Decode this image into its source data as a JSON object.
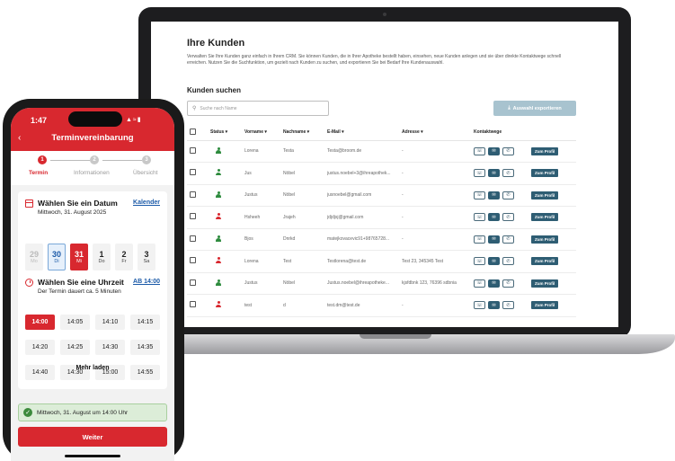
{
  "crm": {
    "title": "Ihre Kunden",
    "description": "Verwalten Sie Ihre Kunden ganz einfach in Ihrem CRM. Sie können Kunden, die in Ihrer Apotheke bestellt haben, einsehen, neue Kunden anlegen und sie über direkte Kontaktwege schnell erreichen. Nutzen Sie die Suchfunktion, um gezielt nach Kunden zu suchen, und exportieren Sie bei Bedarf Ihre Kundenauswahl.",
    "search_heading": "Kunden suchen",
    "search_placeholder": "Suche nach Name",
    "export_label": "Auswahl exportieren",
    "columns": [
      "Status ▾",
      "Vorname ▾",
      "Nachname ▾",
      "E-Mail ▾",
      "Adresse ▾",
      "Kontaktwege"
    ],
    "profile_label": "Zum Profil",
    "status_colors": {
      "active": "#2e8b3e",
      "inactive": "#d8282f"
    },
    "rows": [
      {
        "status": "active",
        "vorname": "Lorena",
        "nachname": "Testa",
        "email": "Testa@broom.de",
        "adresse": "-"
      },
      {
        "status": "active",
        "vorname": "Jus",
        "nachname": "Nöbel",
        "email": "justus.noebel+3@ihreapothek...",
        "adresse": "-"
      },
      {
        "status": "active",
        "vorname": "Justus",
        "nachname": "Nöbel",
        "email": "jusnoebel@gmail.com",
        "adresse": "-"
      },
      {
        "status": "inactive",
        "vorname": "Hsheeh",
        "nachname": "Jrajeh",
        "email": "jdjdjsj@gmail.com",
        "adresse": "-"
      },
      {
        "status": "active",
        "vorname": "Bjos",
        "nachname": "Dnrkd",
        "email": "matejkovacevic91+98765728...",
        "adresse": "-"
      },
      {
        "status": "inactive",
        "vorname": "Lorena",
        "nachname": "Test",
        "email": "Testlorena@test.de",
        "adresse": "Test 23, 345345 Test"
      },
      {
        "status": "active",
        "vorname": "Justus",
        "nachname": "Nöbel",
        "email": "Justus.noebel@ihreapotheke...",
        "adresse": "kjsfdbnk 123, 76396 sdbnia"
      },
      {
        "status": "inactive",
        "vorname": "test",
        "nachname": "d",
        "email": "test.dm@test.de",
        "adresse": "-"
      }
    ]
  },
  "phone": {
    "time": "1:47",
    "title": "Terminvereinbarung",
    "steps": [
      {
        "num": "1",
        "label": "Termin"
      },
      {
        "num": "2",
        "label": "Informationen"
      },
      {
        "num": "3",
        "label": "Übersicht"
      }
    ],
    "date_section": {
      "title": "Wählen Sie ein Datum",
      "subtitle": "Mittwoch, 31. August 2025",
      "link": "Kalender"
    },
    "days": [
      {
        "n": "29",
        "w": "Mo",
        "state": "past"
      },
      {
        "n": "30",
        "w": "Di",
        "state": "sel"
      },
      {
        "n": "31",
        "w": "Mi",
        "state": "today"
      },
      {
        "n": "1",
        "w": "Do",
        "state": ""
      },
      {
        "n": "2",
        "w": "Fr",
        "state": ""
      },
      {
        "n": "3",
        "w": "Sa",
        "state": ""
      }
    ],
    "time_section": {
      "title": "Wählen Sie eine Uhrzeit",
      "subtitle": "Der Termin dauert ca. 5 Minuten",
      "link": "AB 14:00"
    },
    "times": [
      "14:00",
      "14:05",
      "14:10",
      "14:15",
      "14:20",
      "14:25",
      "14:30",
      "14:35",
      "14:40",
      "14:30",
      "15:00",
      "14:55"
    ],
    "selected_time_index": 0,
    "more_label": "Mehr laden",
    "confirmation": "Mittwoch, 31. August um 14:00 Uhr",
    "next_label": "Weiter",
    "accent": "#d8282f"
  }
}
